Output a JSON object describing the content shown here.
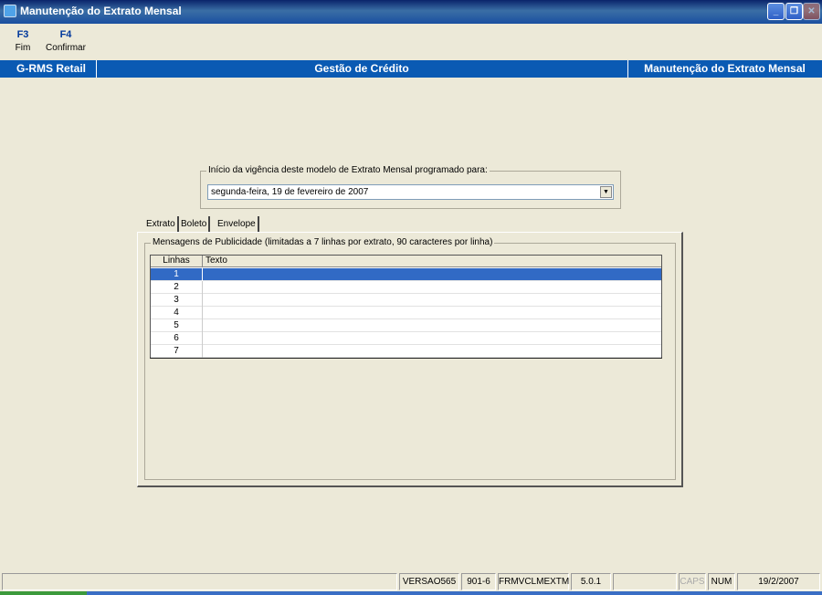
{
  "window": {
    "title": "Manutenção do Extrato Mensal"
  },
  "toolbar": {
    "keys": [
      {
        "key": "F3",
        "label": "Fim"
      },
      {
        "key": "F4",
        "label": "Confirmar"
      }
    ]
  },
  "header": {
    "app": "G-RMS Retail",
    "module": "Gestão de Crédito",
    "screen": "Manutenção do Extrato Mensal"
  },
  "vigencia": {
    "legend": "Início da vigência deste modelo de Extrato Mensal programado para:",
    "value": "segunda-feira, 19 de  fevereiro  de 2007"
  },
  "tabs": [
    "Extrato",
    "Boleto",
    "Envelope"
  ],
  "mensagens": {
    "legend": "Mensagens de Publicidade (limitadas a 7 linhas por extrato, 90 caracteres por linha)",
    "columns": [
      "Linhas",
      "Texto"
    ],
    "rows": [
      "1",
      "2",
      "3",
      "4",
      "5",
      "6",
      "7"
    ],
    "selected_row": "1"
  },
  "status": {
    "version": "VERSAO565",
    "code": "901-6",
    "form": "FRMVCLMEXTM",
    "build": "5.0.1",
    "caps": "CAPS",
    "num": "NUM",
    "date": "19/2/2007"
  }
}
